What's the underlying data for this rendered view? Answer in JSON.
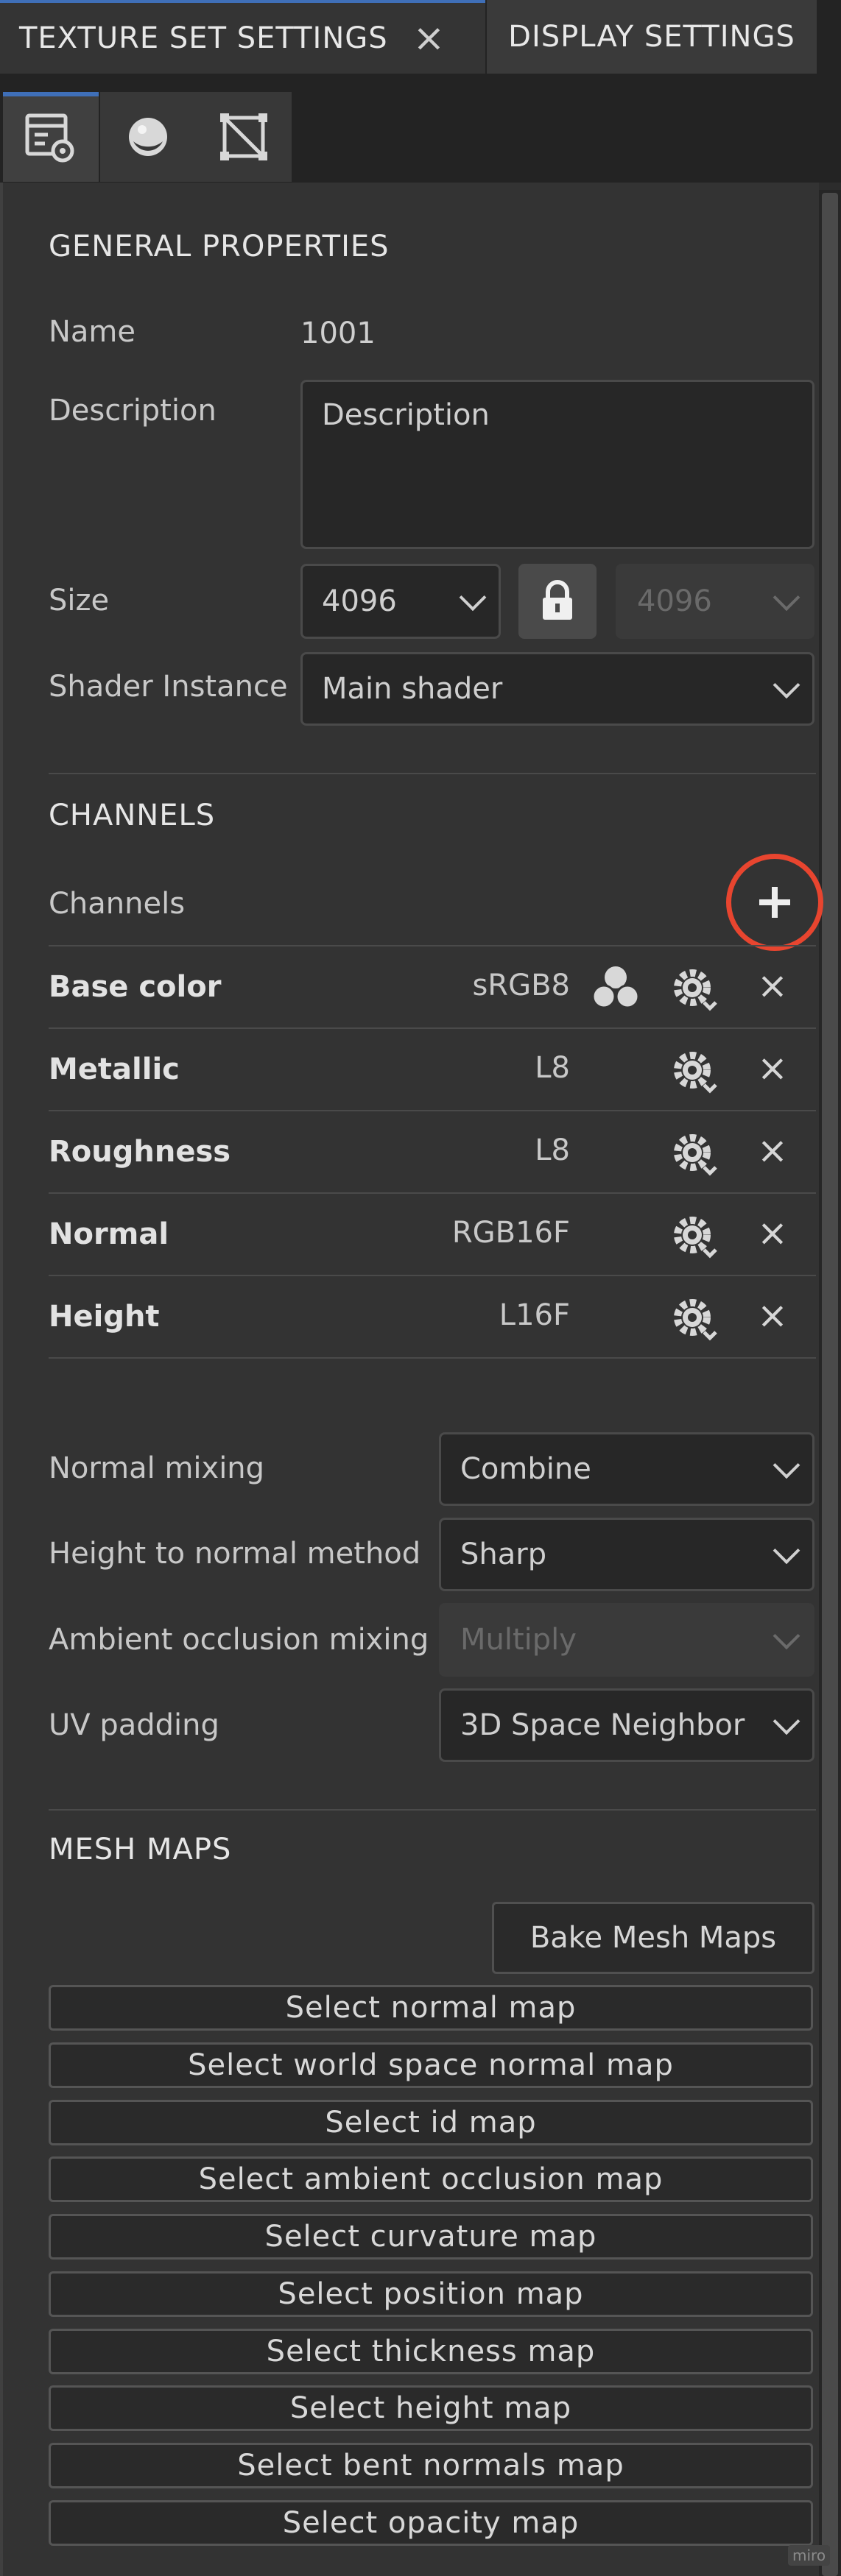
{
  "tabs": {
    "active": "TEXTURE SET SETTINGS",
    "other": "DISPLAY SETTINGS"
  },
  "general": {
    "title": "GENERAL PROPERTIES",
    "name_label": "Name",
    "name_value": "1001",
    "description_label": "Description",
    "description_placeholder": "Description",
    "size_label": "Size",
    "size_value": "4096",
    "size_linked_value": "4096",
    "shader_label": "Shader Instance",
    "shader_value": "Main shader"
  },
  "channels": {
    "title": "CHANNELS",
    "list_label": "Channels",
    "items": [
      {
        "name": "Base color",
        "format": "sRGB8"
      },
      {
        "name": "Metallic",
        "format": "L8"
      },
      {
        "name": "Roughness",
        "format": "L8"
      },
      {
        "name": "Normal",
        "format": "RGB16F"
      },
      {
        "name": "Height",
        "format": "L16F"
      }
    ]
  },
  "settings": {
    "normal_mixing_label": "Normal mixing",
    "normal_mixing_value": "Combine",
    "height_method_label": "Height to normal method",
    "height_method_value": "Sharp",
    "ao_mixing_label": "Ambient occlusion mixing",
    "ao_mixing_value": "Multiply",
    "uv_padding_label": "UV padding",
    "uv_padding_value": "3D Space Neighbor"
  },
  "mesh_maps": {
    "title": "MESH MAPS",
    "bake_label": "Bake Mesh Maps",
    "buttons": [
      "Select normal map",
      "Select world space normal map",
      "Select id map",
      "Select ambient occlusion map",
      "Select curvature map",
      "Select position map",
      "Select thickness map",
      "Select height map",
      "Select bent normals map",
      "Select opacity map"
    ]
  },
  "watermark": "miro",
  "colors": {
    "accent": "#3f6fb8",
    "highlight_ring": "#e8452f"
  },
  "icons": {
    "tab_close": "close-icon",
    "subtabs": [
      "texture-set-settings-icon",
      "material-sphere-icon",
      "uv-geometry-icon"
    ],
    "lock": "lock-icon",
    "add_channel": "plus-icon",
    "channel_color": "color-circles-icon",
    "channel_settings": "gear-icon",
    "channel_remove": "close-icon"
  }
}
